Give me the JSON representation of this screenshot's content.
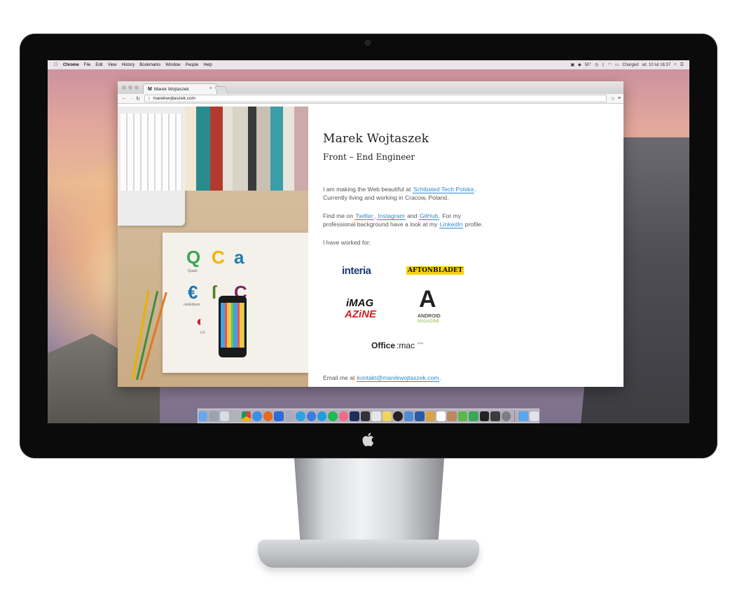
{
  "menubar": {
    "items": [
      "Chrome",
      "File",
      "Edit",
      "View",
      "History",
      "Bookmarks",
      "Window",
      "People",
      "Help"
    ],
    "battery": "Charged",
    "clock": "wt. 10 lut 16:37",
    "temperature": "50°"
  },
  "browser": {
    "tab_title": "Marek Wojtaszek",
    "favicon": "M",
    "url": "marekwojtaszek.com"
  },
  "page": {
    "name": "Marek Wojtaszek",
    "role": "Front – End Engineer",
    "intro_pre": "I am making the Web beautiful at",
    "intro_link": "Schibsted Tech Polska",
    "intro_post": ". Currently living and working in Cracow, Poland.",
    "find_pre": "Find me on",
    "twitter": "Twitter",
    "instagram": "Instagram",
    "and": "and",
    "github": "GitHub",
    "find_mid": ". For my professional background have a look at my",
    "linkedin": "LinkedIn",
    "find_post": "profile.",
    "worked_for": "I have worked for:",
    "clients": {
      "interia": "interia",
      "aftonbladet": "AFTONBLADET",
      "imag": "iMAG",
      "azine": "AZiNE",
      "android_a": "A",
      "android_text": "ANDROID",
      "android_sub": "MAGAZINE",
      "office": "Office",
      "mac": ":mac",
      "office_year": "2011"
    },
    "email_pre": "Email me at",
    "email": "kontakt@marekwojtaszek.com",
    "email_post": "."
  },
  "photo_logos": {
    "quark": "Quark",
    "conedison": "conEdison",
    "lg": "LG"
  },
  "colors": {
    "link": "#2a8ad0",
    "aftonbladet_bg": "#f5d20a",
    "imag_red": "#d51f26",
    "android_green": "#8ab93f"
  },
  "dock": {
    "icons": [
      "finder",
      "launchpad",
      "preview",
      "disk",
      "chrome",
      "safari",
      "firefox",
      "spark",
      "launch",
      "telegram",
      "messenger",
      "skype",
      "spotify",
      "itunes",
      "photoshop",
      "terminal",
      "mail",
      "notes",
      "github",
      "xcode",
      "virtualbox",
      "books",
      "calendar",
      "contacts",
      "evernote",
      "facetime",
      "activity",
      "console",
      "system-prefs",
      "downloads",
      "trash"
    ]
  }
}
